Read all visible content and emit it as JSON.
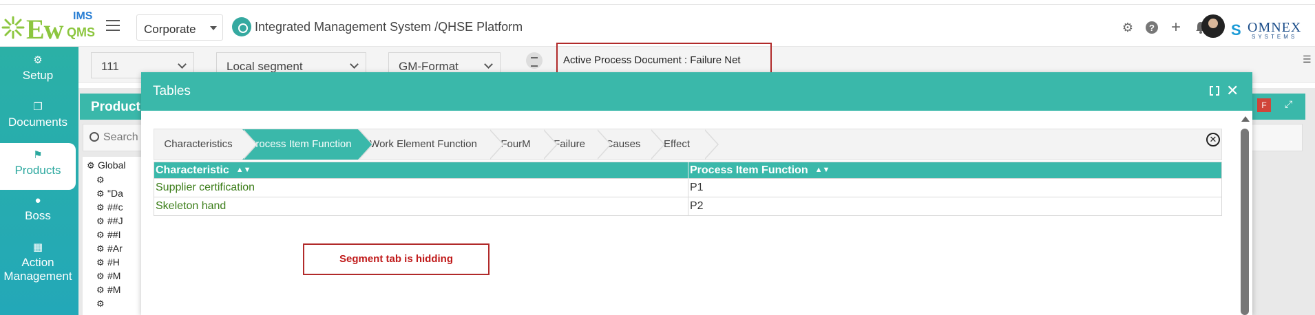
{
  "header": {
    "logo": {
      "ew": "Ew",
      "ims": "IMS",
      "qms": "QMS"
    },
    "org_select": "Corporate",
    "platform_title": "Integrated Management System /QHSE Platform",
    "icons": [
      "gear-icon",
      "help-icon",
      "plus-icon",
      "bell-icon"
    ],
    "brand": {
      "word": "OMNEX",
      "sub": "SYSTEMS"
    }
  },
  "sidebar": {
    "items": [
      {
        "label": "Setup",
        "icon": "cogs-icon"
      },
      {
        "label": "Documents",
        "icon": "copy-icon"
      },
      {
        "label": "Products",
        "icon": "flag-icon",
        "active": true
      },
      {
        "label": "Boss",
        "icon": "user-icon"
      },
      {
        "label": "Action Management",
        "icon": "building-icon"
      }
    ]
  },
  "filters": {
    "first": "111",
    "second": "Local segment",
    "third": "GM-Format"
  },
  "active_doc": "Active Process Document : Failure Net",
  "product_panel": {
    "title": "Product",
    "search_placeholder": "Search",
    "badge": "F",
    "tree_root": "Global",
    "tree_items": [
      "",
      "\"Da",
      "##c",
      "##J",
      "##I",
      "#Ar",
      "#H",
      "#M",
      "#M",
      ""
    ]
  },
  "modal": {
    "title": "Tables",
    "tabs": [
      "Characteristics",
      "Process Item Function",
      "Work Element Function",
      "FourM",
      "Failure",
      "Causes",
      "Effect"
    ],
    "active_tab": 1,
    "table": {
      "columns": [
        "Characteristic",
        "Process Item Function"
      ],
      "rows": [
        [
          "Supplier certification",
          "P1"
        ],
        [
          "Skeleton hand",
          "P2"
        ]
      ]
    },
    "note": "Segment tab is hidding"
  }
}
